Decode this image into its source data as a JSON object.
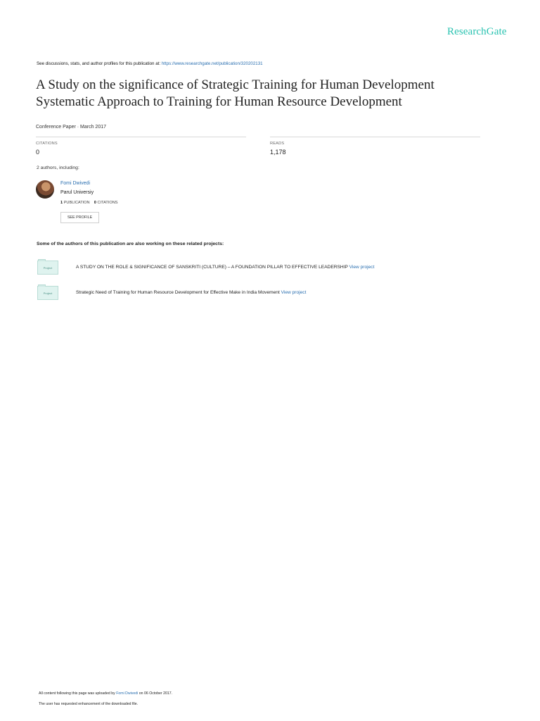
{
  "brand": {
    "name": "ResearchGate"
  },
  "header": {
    "discuss_text": "See discussions, stats, and author profiles for this publication at:",
    "publication_url": "https://www.researchgate.net/publication/320202131"
  },
  "paper": {
    "title_line1": "A Study on the significance of Strategic Training for Human Development",
    "title_line2": "Systematic Approach to Training for Human Resource Development",
    "meta": "Conference Paper · March 2017"
  },
  "stats": {
    "citations_label": "CITATIONS",
    "citations_value": "0",
    "reads_label": "READS",
    "reads_value": "1,178"
  },
  "authors": {
    "heading": "2 authors, including:",
    "items": [
      {
        "name": "Fomi Dwivedi",
        "affiliation": "Parul Universiy",
        "publications_count": "1",
        "publications_label": "PUBLICATION",
        "citations_count": "0",
        "citations_label": "CITATIONS",
        "see_profile_label": "SEE PROFILE"
      }
    ]
  },
  "projects": {
    "heading": "Some of the authors of this publication are also working on these related projects:",
    "icon_label": "Project",
    "view_label": "View project",
    "items": [
      {
        "title": "A STUDY ON THE ROLE & SIGNIFICANCE OF SANSKRITI (CULTURE) – A FOUNDATION PILLAR TO EFFECTIVE LEADERSHIP"
      },
      {
        "title": "Strategic Need of Training for Human Resource Development for Effective Make in India Movement"
      }
    ]
  },
  "footer": {
    "uploaded_prefix": "All content following this page was uploaded by",
    "uploader": "Fomi Dwivedi",
    "uploaded_suffix": "on 06 October 2017.",
    "enhancement_note": "The user has requested enhancement of the downloaded file."
  },
  "colors": {
    "brand": "#28c2b0",
    "link": "#2a6fb0"
  }
}
